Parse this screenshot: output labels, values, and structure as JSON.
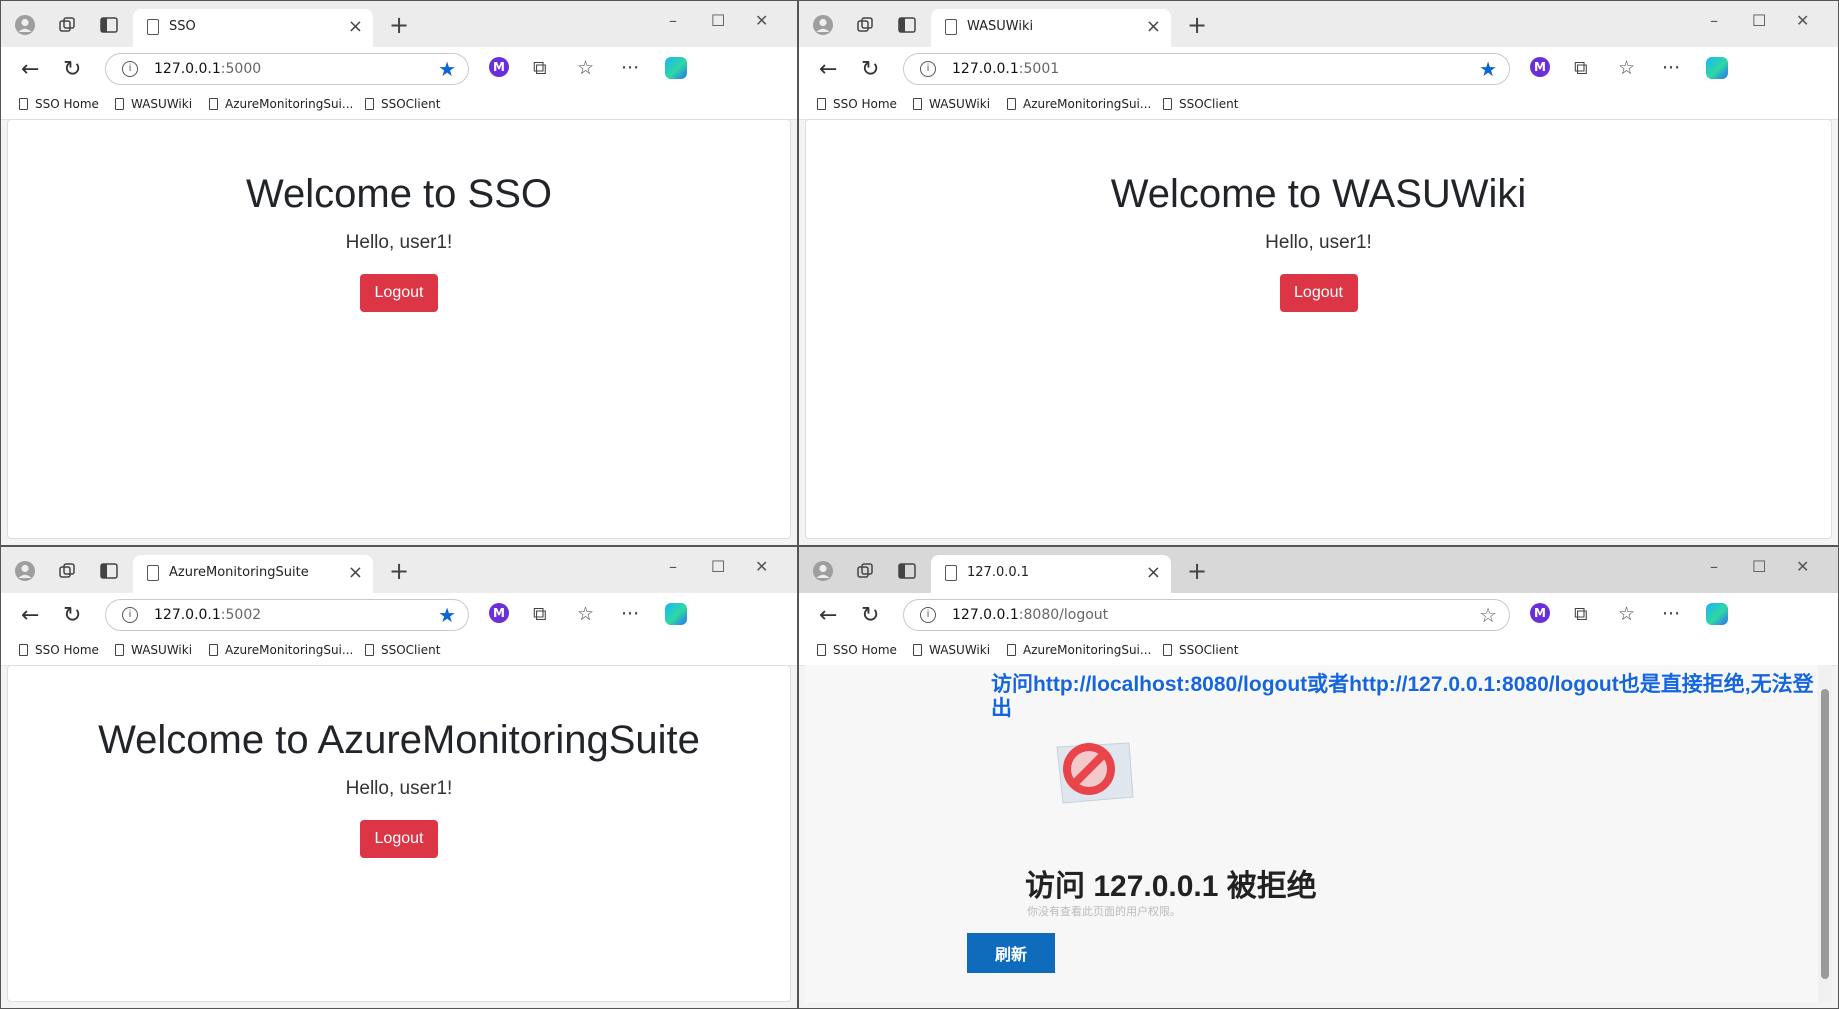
{
  "windows": [
    {
      "id": "sso",
      "tab_title": "SSO",
      "url_host": "127.0.0.1",
      "url_path": ":5000",
      "bookmarked": true,
      "heading": "Welcome to SSO",
      "greeting": "Hello, user1!",
      "logout_label": "Logout"
    },
    {
      "id": "wasuwiki",
      "tab_title": "WASUWiki",
      "url_host": "127.0.0.1",
      "url_path": ":5001",
      "bookmarked": true,
      "heading": "Welcome to WASUWiki",
      "greeting": "Hello, user1!",
      "logout_label": "Logout"
    },
    {
      "id": "azure",
      "tab_title": "AzureMonitoringSuite",
      "url_host": "127.0.0.1",
      "url_path": ":5002",
      "bookmarked": true,
      "heading": "Welcome to AzureMonitoringSuite",
      "greeting": "Hello, user1!",
      "logout_label": "Logout"
    },
    {
      "id": "logout",
      "tab_title": "127.0.0.1",
      "url_host": "127.0.0.1",
      "url_path": ":8080/logout",
      "bookmarked": false,
      "annotation": "访问http://localhost:8080/logout或者http://127.0.0.1:8080/logout也是直接拒绝,无法登出",
      "error_title": "访问 127.0.0.1 被拒绝",
      "error_subtitle": "你没有查看此页面的用户权限。",
      "refresh_label": "刷新"
    }
  ],
  "bookmarks": [
    "SSO Home",
    "WASUWiki",
    "AzureMonitoringSui...",
    "SSOClient"
  ],
  "icons": {
    "profile": "profile-avatar-icon",
    "workspaces": "workspaces-icon",
    "vertical_tabs": "vertical-tabs-icon",
    "page": "page-icon",
    "close": "close-icon",
    "new_tab": "plus-icon",
    "back": "back-arrow-icon",
    "refresh": "refresh-icon",
    "star": "star-icon",
    "extensions": "puzzle-icon",
    "favorites": "favorites-icon",
    "more": "more-icon",
    "copilot": "copilot-icon"
  },
  "colors": {
    "logout_button": "#dc3545",
    "refresh_button": "#0f6cbd",
    "annotation_text": "#1565e0",
    "star_active": "#0a66d6"
  }
}
